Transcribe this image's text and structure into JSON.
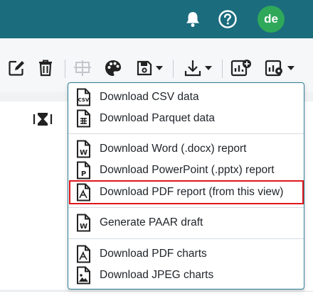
{
  "header": {
    "bell_icon": "bell-icon",
    "help_icon": "help-icon",
    "avatar_initials": "de",
    "colors": {
      "background": "#1b6c7d",
      "avatar": "#2fa85a"
    }
  },
  "toolbar": {
    "buttons": [
      {
        "icon": "edit-icon"
      },
      {
        "icon": "trash-icon"
      },
      {
        "icon": "transform-icon",
        "disabled": true
      },
      {
        "icon": "palette-icon"
      },
      {
        "icon": "save-icon",
        "has_caret": true
      },
      {
        "icon": "download-icon",
        "has_caret": true
      },
      {
        "icon": "add-chart-icon"
      },
      {
        "icon": "chart-options-icon",
        "has_caret": true
      }
    ]
  },
  "export_menu": {
    "items": [
      {
        "label": "Download CSV data",
        "icon": "csv-file-icon"
      },
      {
        "label": "Download Parquet data",
        "icon": "parquet-file-icon"
      },
      {
        "label": "Download Word (.docx) report",
        "icon": "word-file-icon"
      },
      {
        "label": "Download PowerPoint (.pptx) report",
        "icon": "powerpoint-file-icon"
      },
      {
        "label": "Download PDF report (from this view)",
        "icon": "pdf-file-icon",
        "highlighted": true
      },
      {
        "label": "Generate PAAR draft",
        "icon": "word-file-icon"
      },
      {
        "label": "Download PDF charts",
        "icon": "pdf-file-icon"
      },
      {
        "label": "Download JPEG charts",
        "icon": "image-file-icon"
      }
    ],
    "colors": {
      "border": "#2d7f95",
      "highlight": "#e0161b"
    }
  }
}
